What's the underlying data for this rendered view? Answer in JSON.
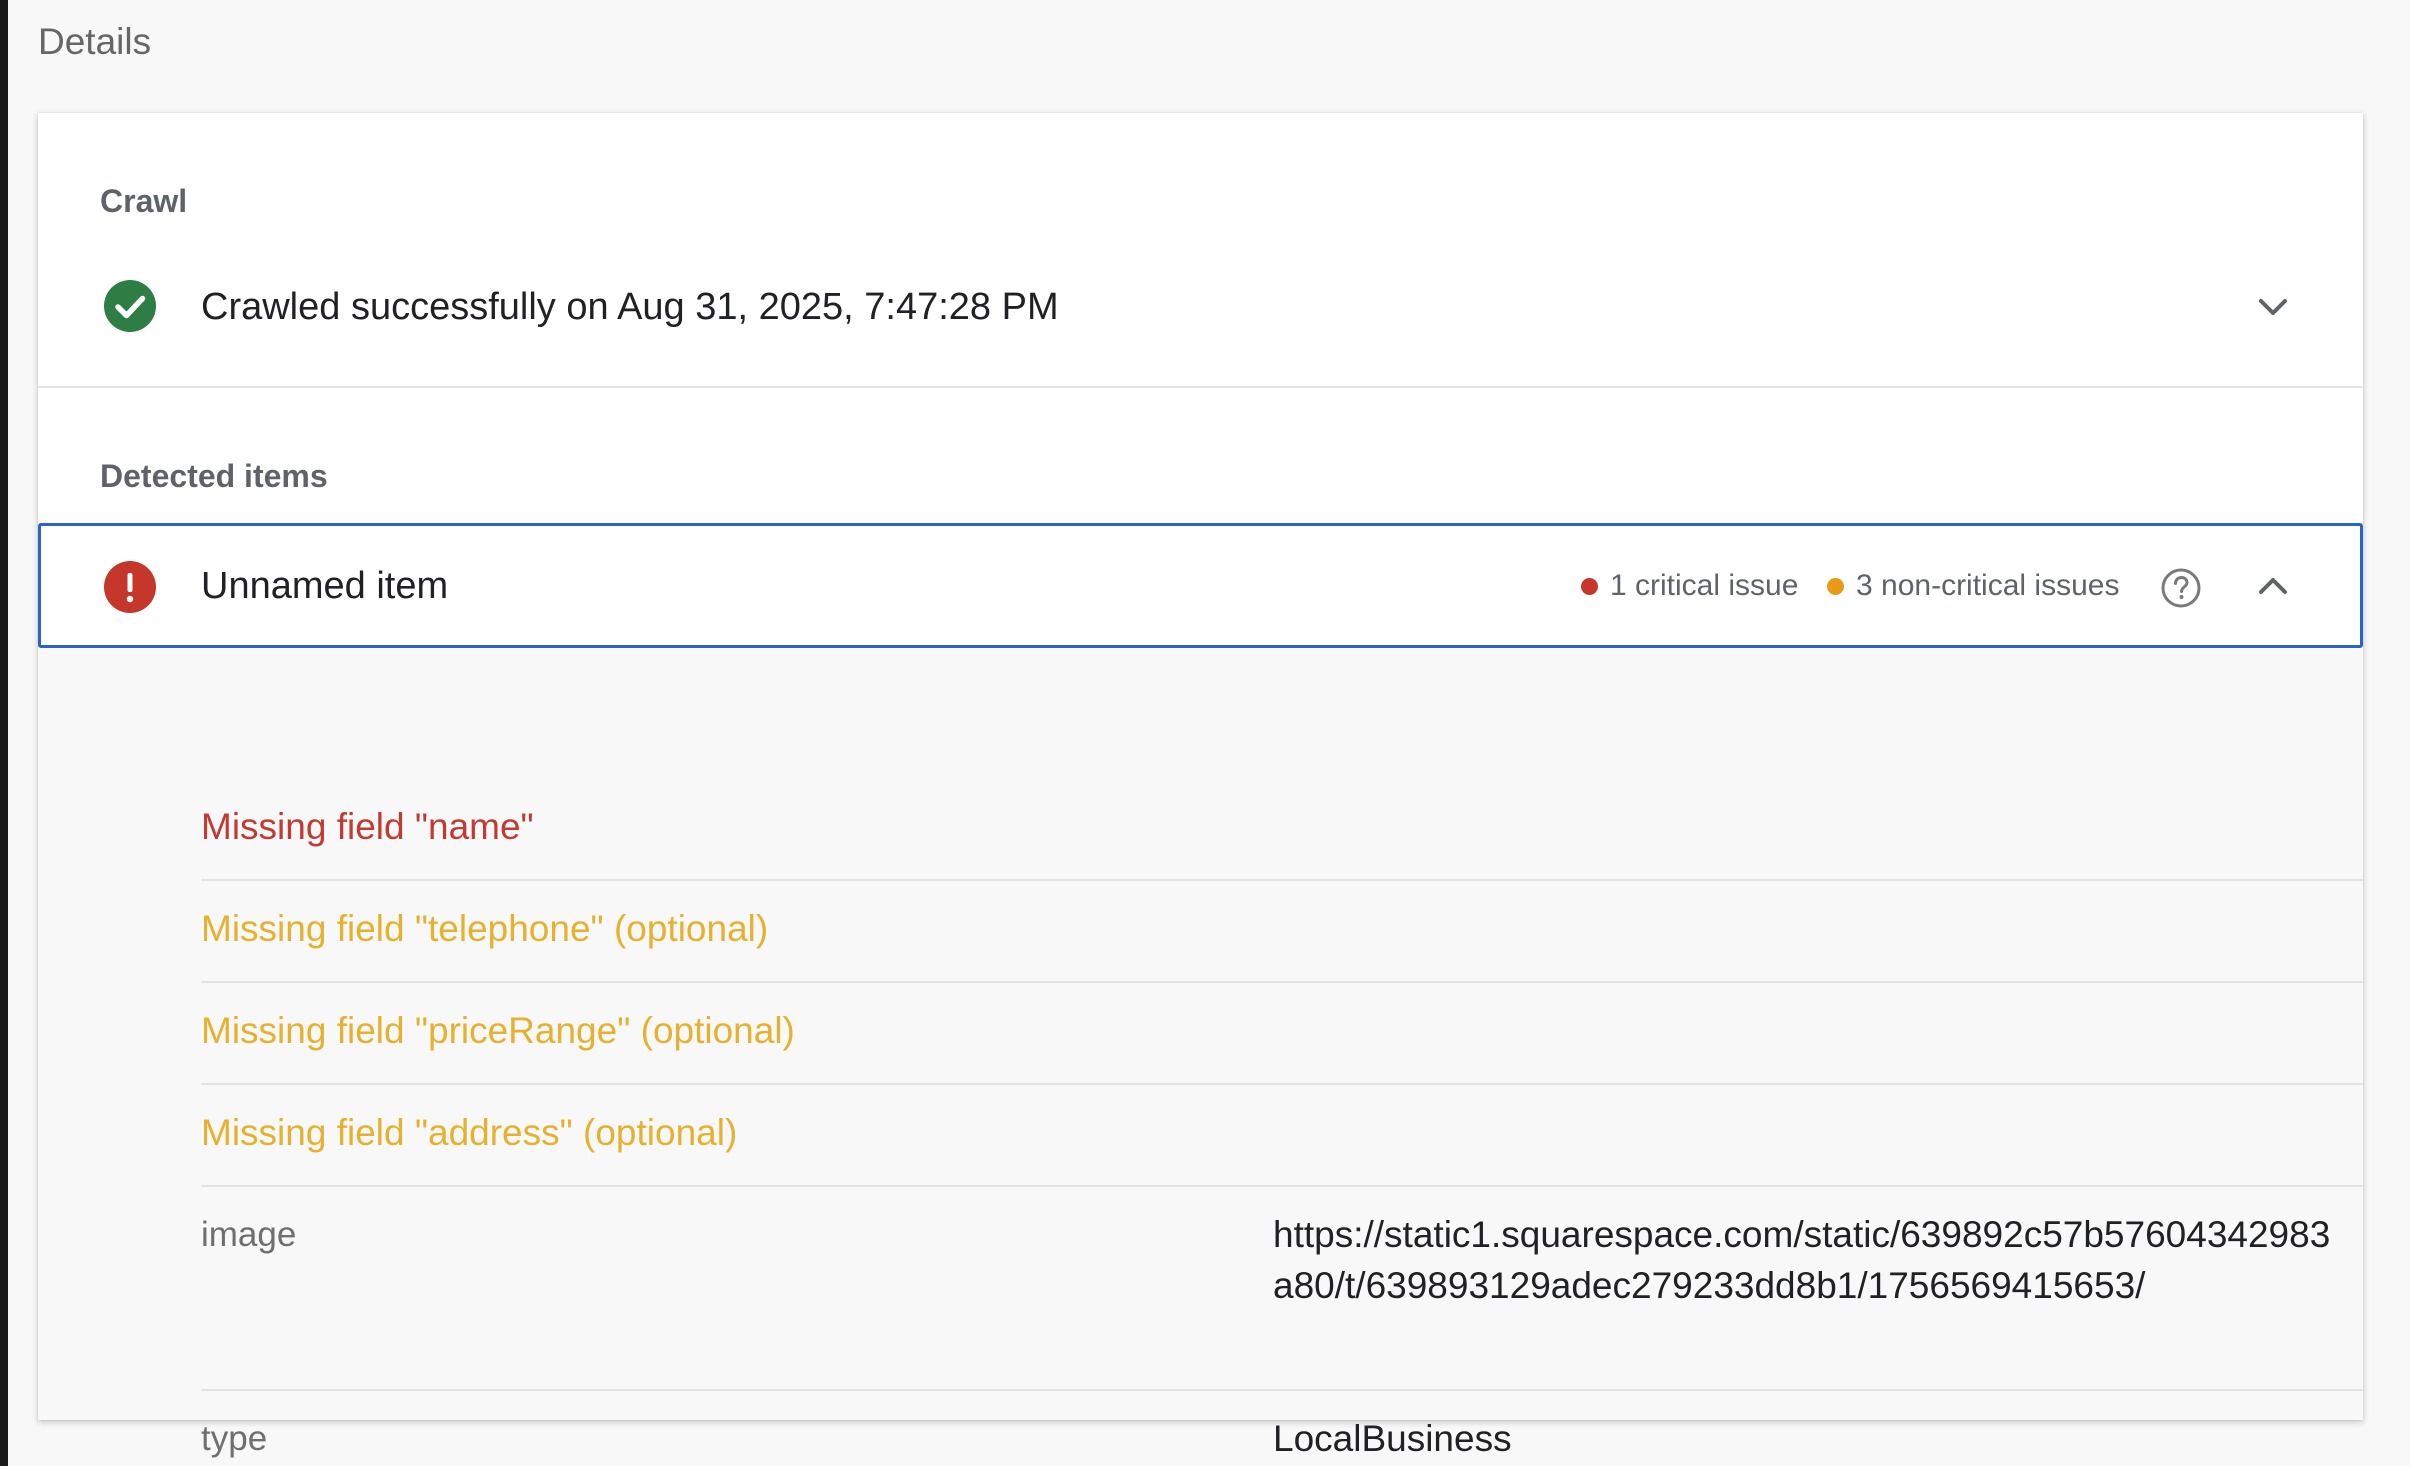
{
  "page": {
    "header": "Details"
  },
  "crawl": {
    "section_label": "Crawl",
    "status_text": "Crawled successfully on Aug 31, 2025, 7:47:28 PM",
    "status": "success",
    "status_icon": "check-circle-icon",
    "status_color": "#2e7d44",
    "expand_icon": "chevron-down-icon"
  },
  "detected": {
    "section_label": "Detected items",
    "item": {
      "title": "Unnamed item",
      "status_icon": "error-circle-icon",
      "status_color": "#c5362b",
      "critical_count_label": "1 critical issue",
      "noncritical_count_label": "3 non-critical issues",
      "help_icon": "help-circle-icon",
      "collapse_icon": "chevron-up-icon",
      "accent_color": "#2b63c9",
      "issues": [
        {
          "text": "Missing field \"name\"",
          "severity": "critical",
          "color": "#c23b32"
        },
        {
          "text": "Missing field \"telephone\" (optional)",
          "severity": "warning",
          "color": "#e6b12f"
        },
        {
          "text": "Missing field \"priceRange\" (optional)",
          "severity": "warning",
          "color": "#e6b12f"
        },
        {
          "text": "Missing field \"address\" (optional)",
          "severity": "warning",
          "color": "#e6b12f"
        }
      ],
      "properties": [
        {
          "name": "image",
          "value": "https://static1.squarespace.com/static/639892c57b57604342983a80/t/639893129adec279233dd8b1/1756569415653/"
        },
        {
          "name": "type",
          "value": "LocalBusiness"
        }
      ]
    }
  }
}
